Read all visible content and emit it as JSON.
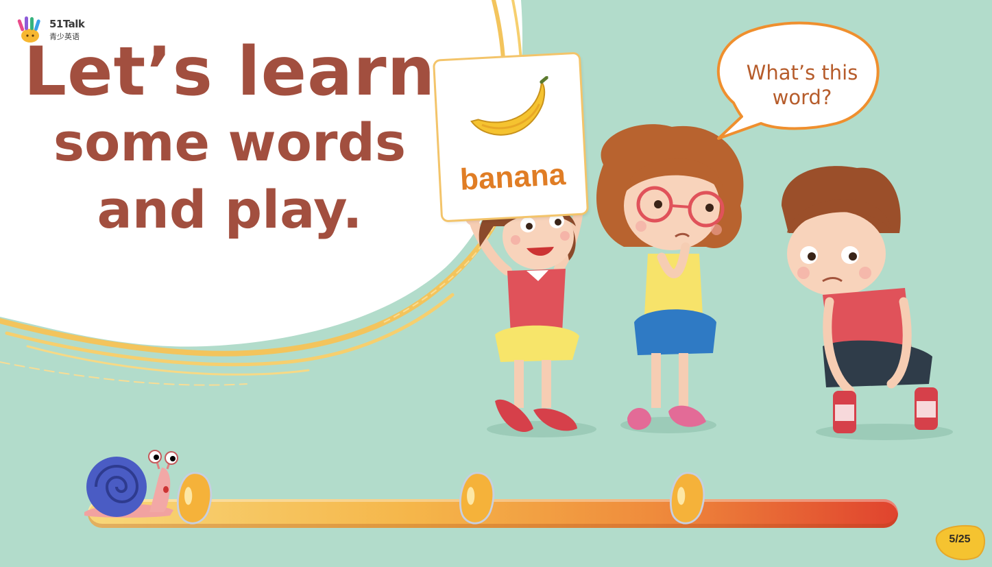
{
  "logo": {
    "brand": "51Talk",
    "sub": "青少英语"
  },
  "title": {
    "line1": "Let’s learn",
    "line2": "some words",
    "line3": "and play."
  },
  "flashcard": {
    "word": "banana",
    "icon": "banana-icon"
  },
  "speech_bubble": {
    "text": "What’s this word?"
  },
  "progress": {
    "current": 5,
    "total": 25,
    "label": "5/25",
    "beans_collected": 3
  },
  "colors": {
    "background": "#b2dccb",
    "title": "#a24f3f",
    "card_word": "#e07d25",
    "bubble_outline": "#ef8f2e",
    "bar_start": "#f8d77a",
    "bar_end": "#e0432e"
  }
}
